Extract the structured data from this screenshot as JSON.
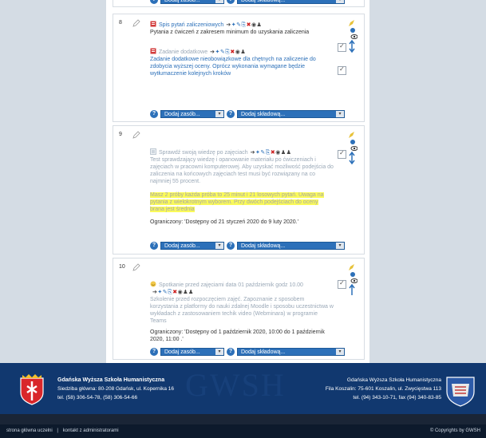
{
  "add_resource_label": "Dodaj zasób...",
  "add_component_label": "Dodaj składową...",
  "help_glyph": "?",
  "sections": [
    {
      "number": "8",
      "activities": [
        {
          "title": "Spis pytań zaliczeniowych",
          "desc": "Pytania z ćwiczeń z zakresem minimum do uzyskania zaliczenia"
        },
        {
          "title": "Zadanie dodatkowe",
          "desc": "Zadanie dodatkowe nieobowiązkowe dla chętnych na zaliczenie do zdobycia wyższej oceny. Oprócz wykonania wymagane będzie wytłumaczenie kolejnych kroków"
        }
      ]
    },
    {
      "number": "9",
      "activities": [
        {
          "title": "Sprawdź swoją wiedzę po zajęciach",
          "desc": "Test sprawdzający wiedzę i opanowanie materiału po ćwiczeniach i zajęciach w pracowni komputerowej. Aby uzyskać możliwość podejścia do zaliczenia na końcowych zajęciach test musi być rozwiązany na co najmniej 55 procent.",
          "highlight": "Masz 2 próby każda próba to 25 minut i 21 losowych pytań. Uwaga na pytania z wielokrotnym wyborem. Przy dwóch podejściach do oceny brana jest średnia",
          "restriction": "Ograniczony: 'Dostępny od 21 styczeń 2020 do 9 luty 2020.'"
        }
      ]
    },
    {
      "number": "10",
      "activities": [
        {
          "title": "Spotkanie przed zajęciami data 01 październik godz 10.00",
          "desc": "Szkolenie przed rozpoczęciem zajęć. Zapoznanie z sposobem korzystania z platformy do nauki zdalnej Moodle i sposobu uczestnictwa w wykładach z zastosowaniem techik video (Webminara) w programie Teams",
          "restriction": "Ograniczony: 'Dostępny od 1 październik 2020, 10:00 do 1 październik 2020, 11:00 .'"
        }
      ]
    }
  ],
  "footer": {
    "left_name": "Gdańska Wyższa Szkoła Humanistyczna",
    "left_address": "Siedziba główna: 80-208 Gdańsk, ul. Kopernika 16",
    "left_phone": "tel. (58) 306-54-78, (58) 306-54-66",
    "watermark": "GWSH",
    "right_name": "Gdańska Wyższa Szkoła Humanistyczna",
    "right_address": "Fila Koszalin: 75-601 Koszalin, ul. Zwycięstwa 113",
    "right_phone": "tel. (94) 343-10-71, fax (94) 340-83-85",
    "link_home": "strona główna uczelni",
    "separator": "|",
    "link_admin": "kontakt z administratorami",
    "copyright": "© Copyrights by GWSH"
  }
}
